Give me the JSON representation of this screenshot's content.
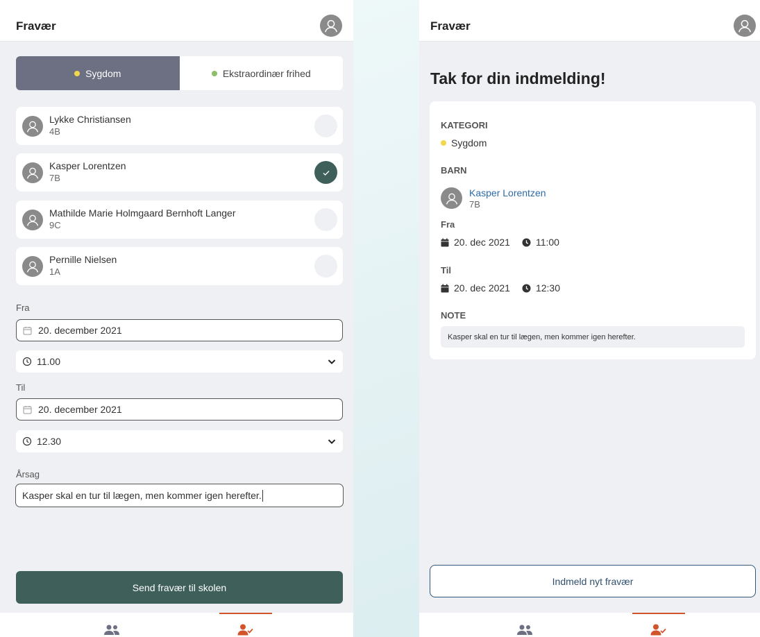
{
  "colors": {
    "sick_dot": "#f0d84a",
    "leave_dot": "#8bbf6a",
    "primary": "#3f5f5b",
    "accent": "#d2542a",
    "link": "#2c6aa8"
  },
  "form_screen": {
    "title": "Fravær",
    "avatar_icon": "user-avatar-icon",
    "categories": [
      {
        "label": "Sygdom",
        "selected": true
      },
      {
        "label": "Ekstraordinær frihed",
        "selected": false
      }
    ],
    "children": [
      {
        "name": "Lykke Christiansen",
        "class": "4B",
        "selected": false
      },
      {
        "name": "Kasper Lorentzen",
        "class": "7B",
        "selected": true
      },
      {
        "name": "Mathilde Marie Holmgaard Bernhoft Langer",
        "class": "9C",
        "selected": false
      },
      {
        "name": "Pernille Nielsen",
        "class": "1A",
        "selected": false
      }
    ],
    "from_label": "Fra",
    "from_date": "20. december 2021",
    "from_time": "11.00",
    "to_label": "Til",
    "to_date": "20. december 2021",
    "to_time": "12.30",
    "reason_label": "Årsag",
    "reason_value": "Kasper skal en tur til lægen, men kommer igen herefter.",
    "submit_label": "Send fravær til skolen"
  },
  "confirm_screen": {
    "title": "Fravær",
    "heading": "Tak for din indmelding!",
    "category_heading": "KATEGORI",
    "category_value": "Sygdom",
    "child_heading": "BARN",
    "child_name": "Kasper Lorentzen",
    "child_class": "7B",
    "from_label": "Fra",
    "from_date": "20. dec 2021",
    "from_time": "11:00",
    "to_label": "Til",
    "to_date": "20. dec 2021",
    "to_time": "12:30",
    "note_heading": "NOTE",
    "note_value": "Kasper skal en tur til lægen, men kommer igen herefter.",
    "new_button_label": "Indmeld nyt fravær"
  },
  "bottom_nav": [
    {
      "icon": "people-icon",
      "active": false
    },
    {
      "icon": "user-check-icon",
      "active": true
    }
  ]
}
